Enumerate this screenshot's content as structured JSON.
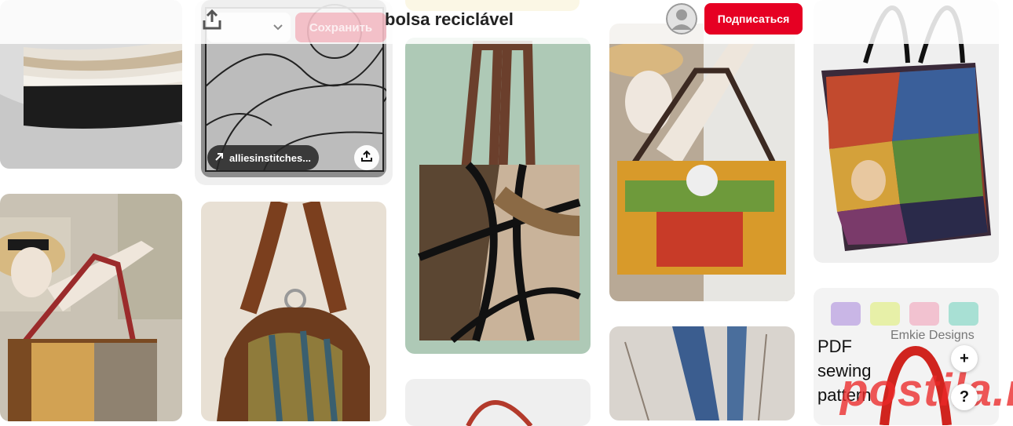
{
  "header": {
    "board_title": "bolsa reciclável",
    "follow_label": "Подписаться",
    "save_label": "Сохранить"
  },
  "pins": [
    {
      "name": "pin-white-quilted-bag"
    },
    {
      "name": "pin-pattern-template",
      "source_label": "alliesinstitches..."
    },
    {
      "name": "pin-stained-glass-tote"
    },
    {
      "name": "pin-boho-embroidered-bag"
    },
    {
      "name": "pin-crazy-quilt-tote"
    },
    {
      "name": "pin-mannequin-boho-bag"
    },
    {
      "name": "pin-leather-hobo-bag"
    },
    {
      "name": "pin-striped-bag"
    },
    {
      "name": "pin-necktie-bag"
    },
    {
      "name": "pin-pdf-sewing-pattern",
      "pattern_text": [
        "PDF",
        "sewing",
        "pattern"
      ],
      "brand": "Emkie Designs",
      "watermark": "postila.ru"
    }
  ],
  "fab": {
    "zoom_in": "+",
    "help": "?"
  },
  "colors": {
    "accent": "#e60023",
    "card_bg": "#efefef"
  }
}
